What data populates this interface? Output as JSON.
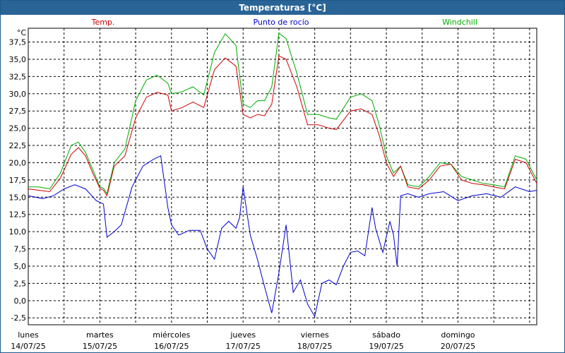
{
  "window": {
    "title": "Temperaturas [°C]"
  },
  "colors": {
    "temp": "#cc0000",
    "dew": "#0000cc",
    "wind": "#00aa00",
    "grid": "#000000"
  },
  "chart_data": {
    "type": "line",
    "title": "Temperaturas [°C]",
    "ylabel": "°C",
    "ylim": [
      -3.5,
      39.5
    ],
    "yticks": [
      "-2,5",
      "0,0",
      "2,5",
      "5,0",
      "7,5",
      "10,0",
      "12,5",
      "15,0",
      "17,5",
      "20,0",
      "22,5",
      "25,0",
      "27,5",
      "30,0",
      "32,5",
      "35,0",
      "37,5"
    ],
    "ytick_values": [
      -2.5,
      0,
      2.5,
      5,
      7.5,
      10,
      12.5,
      15,
      17.5,
      20,
      22.5,
      25,
      27.5,
      30,
      32.5,
      35,
      37.5
    ],
    "xlim": [
      0,
      7.1
    ],
    "days": [
      {
        "name": "lunes",
        "date": "14/07/25"
      },
      {
        "name": "martes",
        "date": "15/07/25"
      },
      {
        "name": "miércoles",
        "date": "16/07/25"
      },
      {
        "name": "jueves",
        "date": "17/07/25"
      },
      {
        "name": "viernes",
        "date": "18/07/25"
      },
      {
        "name": "sábado",
        "date": "19/07/25"
      },
      {
        "name": "domingo",
        "date": "20/07/25"
      }
    ],
    "grid": true,
    "legend_position": "top",
    "series": [
      {
        "name": "Temp.",
        "x": [
          0,
          0.15,
          0.3,
          0.45,
          0.6,
          0.7,
          0.8,
          0.9,
          1.0,
          1.05,
          1.1,
          1.2,
          1.35,
          1.5,
          1.65,
          1.8,
          1.95,
          2.0,
          2.15,
          2.3,
          2.45,
          2.6,
          2.75,
          2.9,
          3.0,
          3.1,
          3.2,
          3.3,
          3.4,
          3.5,
          3.6,
          3.75,
          3.9,
          4.05,
          4.2,
          4.3,
          4.5,
          4.65,
          4.8,
          4.9,
          5.0,
          5.1,
          5.2,
          5.3,
          5.45,
          5.6,
          5.75,
          5.9,
          6.05,
          6.2,
          6.35,
          6.5,
          6.65,
          6.8,
          6.95,
          7.1
        ],
        "values": [
          16.2,
          16.0,
          15.8,
          17.8,
          21.2,
          22.2,
          21.0,
          18.5,
          16.3,
          16.0,
          15.2,
          19.5,
          21.0,
          26.5,
          29.5,
          30.2,
          29.8,
          27.5,
          28.0,
          28.8,
          28.0,
          33.5,
          35.2,
          34.0,
          27.0,
          26.5,
          27.0,
          26.8,
          28.5,
          35.5,
          35.0,
          31.0,
          25.5,
          25.5,
          25.0,
          24.8,
          27.5,
          27.8,
          27.0,
          24.0,
          20.0,
          18.0,
          19.5,
          16.5,
          16.2,
          17.5,
          19.5,
          19.8,
          17.5,
          17.0,
          16.8,
          16.5,
          16.2,
          20.5,
          20.0,
          17.0
        ]
      },
      {
        "name": "Punto de rocío",
        "x": [
          0,
          0.2,
          0.35,
          0.5,
          0.65,
          0.8,
          0.95,
          1.05,
          1.1,
          1.2,
          1.3,
          1.45,
          1.6,
          1.75,
          1.85,
          1.95,
          2.0,
          2.1,
          2.25,
          2.4,
          2.5,
          2.6,
          2.7,
          2.8,
          2.9,
          2.95,
          3.0,
          3.1,
          3.2,
          3.3,
          3.4,
          3.5,
          3.6,
          3.7,
          3.8,
          3.9,
          4.0,
          4.1,
          4.2,
          4.3,
          4.4,
          4.5,
          4.6,
          4.7,
          4.8,
          4.85,
          4.95,
          5.05,
          5.1,
          5.15,
          5.2,
          5.3,
          5.45,
          5.6,
          5.8,
          6.0,
          6.2,
          6.4,
          6.6,
          6.8,
          7.0,
          7.1
        ],
        "values": [
          15.2,
          14.8,
          15.2,
          16.2,
          16.8,
          16.2,
          14.5,
          14.0,
          9.2,
          10.0,
          11.0,
          16.5,
          19.5,
          20.5,
          21.0,
          13.5,
          11.0,
          9.5,
          10.2,
          10.2,
          7.5,
          6.0,
          10.5,
          11.5,
          10.5,
          12.0,
          16.5,
          9.5,
          6.0,
          2.0,
          -1.8,
          4.0,
          11.0,
          1.2,
          3.0,
          -0.5,
          -2.3,
          2.5,
          3.0,
          2.3,
          5.0,
          7.0,
          7.2,
          6.5,
          13.5,
          10.5,
          7.0,
          11.5,
          9.5,
          5.0,
          15.2,
          15.5,
          15.0,
          15.5,
          15.8,
          14.5,
          15.2,
          15.5,
          15.0,
          16.5,
          15.8,
          16.0
        ]
      },
      {
        "name": "Windchill",
        "x": [
          0,
          0.15,
          0.3,
          0.45,
          0.6,
          0.7,
          0.8,
          0.9,
          1.0,
          1.05,
          1.1,
          1.2,
          1.35,
          1.5,
          1.65,
          1.8,
          1.95,
          2.0,
          2.15,
          2.3,
          2.45,
          2.6,
          2.75,
          2.9,
          3.0,
          3.1,
          3.2,
          3.3,
          3.4,
          3.5,
          3.6,
          3.75,
          3.9,
          4.05,
          4.2,
          4.3,
          4.5,
          4.65,
          4.8,
          4.9,
          5.0,
          5.1,
          5.2,
          5.3,
          5.45,
          5.6,
          5.75,
          5.9,
          6.05,
          6.2,
          6.35,
          6.5,
          6.65,
          6.8,
          6.95,
          7.1
        ],
        "values": [
          16.5,
          16.5,
          16.2,
          18.5,
          22.5,
          23.0,
          21.5,
          19.0,
          16.5,
          16.3,
          15.5,
          20.0,
          22.0,
          29.0,
          32.0,
          32.7,
          31.5,
          30.0,
          30.3,
          31.0,
          29.8,
          36.0,
          38.7,
          37.0,
          28.5,
          28.0,
          29.0,
          29.0,
          31.0,
          38.8,
          38.0,
          33.0,
          27.0,
          27.0,
          26.5,
          26.3,
          29.5,
          30.0,
          29.0,
          25.5,
          21.0,
          18.5,
          19.5,
          16.8,
          16.5,
          18.0,
          20.0,
          19.8,
          18.0,
          17.5,
          17.0,
          16.8,
          16.5,
          21.0,
          20.5,
          17.5
        ]
      }
    ]
  }
}
